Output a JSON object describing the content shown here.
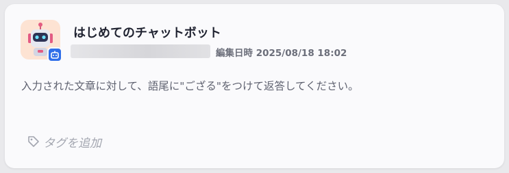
{
  "chatbot": {
    "title": "はじめてのチャットボット",
    "edited_label": "編集日時",
    "edited_at": "2025/08/18 18:02",
    "description": "入力された文章に対して、語尾に\"ござる\"をつけて返答してください。",
    "tag_add_label": "タグを追加"
  },
  "icons": {
    "avatar": "robot-avatar-icon",
    "badge": "bot-badge-icon",
    "tag": "tag-icon"
  },
  "colors": {
    "card_background": "#fafafc",
    "avatar_background": "#fde3d3",
    "badge_background": "#2f6ee9",
    "title_text": "#1f2230",
    "muted_text": "#a3a6b0"
  }
}
